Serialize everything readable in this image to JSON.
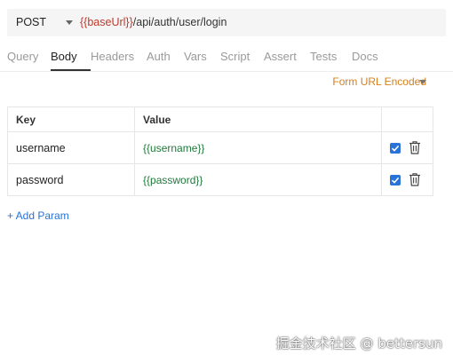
{
  "request": {
    "method": "POST",
    "url_var": "{{baseUrl}}",
    "url_path": "/api/auth/user/login"
  },
  "tabs": [
    "Query",
    "Body",
    "Headers",
    "Auth",
    "Vars",
    "Script",
    "Assert",
    "Tests",
    "Docs"
  ],
  "active_tab": "Body",
  "body": {
    "encoding": "Form URL Encoded",
    "columns": {
      "key": "Key",
      "value": "Value"
    },
    "params": [
      {
        "key": "username",
        "value": "{{username}}",
        "enabled": true
      },
      {
        "key": "password",
        "value": "{{password}}",
        "enabled": true
      }
    ],
    "add_label": "+ Add Param"
  },
  "watermark": "掘金技术社区 @ bettersun",
  "colors": {
    "accent": "#2872d8",
    "variable": "#c0392b",
    "value_text": "#1f7a3a",
    "encoding": "#d4801c"
  },
  "icons": {
    "method_dropdown": "chevron-down-icon",
    "encoding_dropdown": "chevron-down-icon",
    "enabled": "checkbox-checked-icon",
    "delete": "trash-icon"
  }
}
